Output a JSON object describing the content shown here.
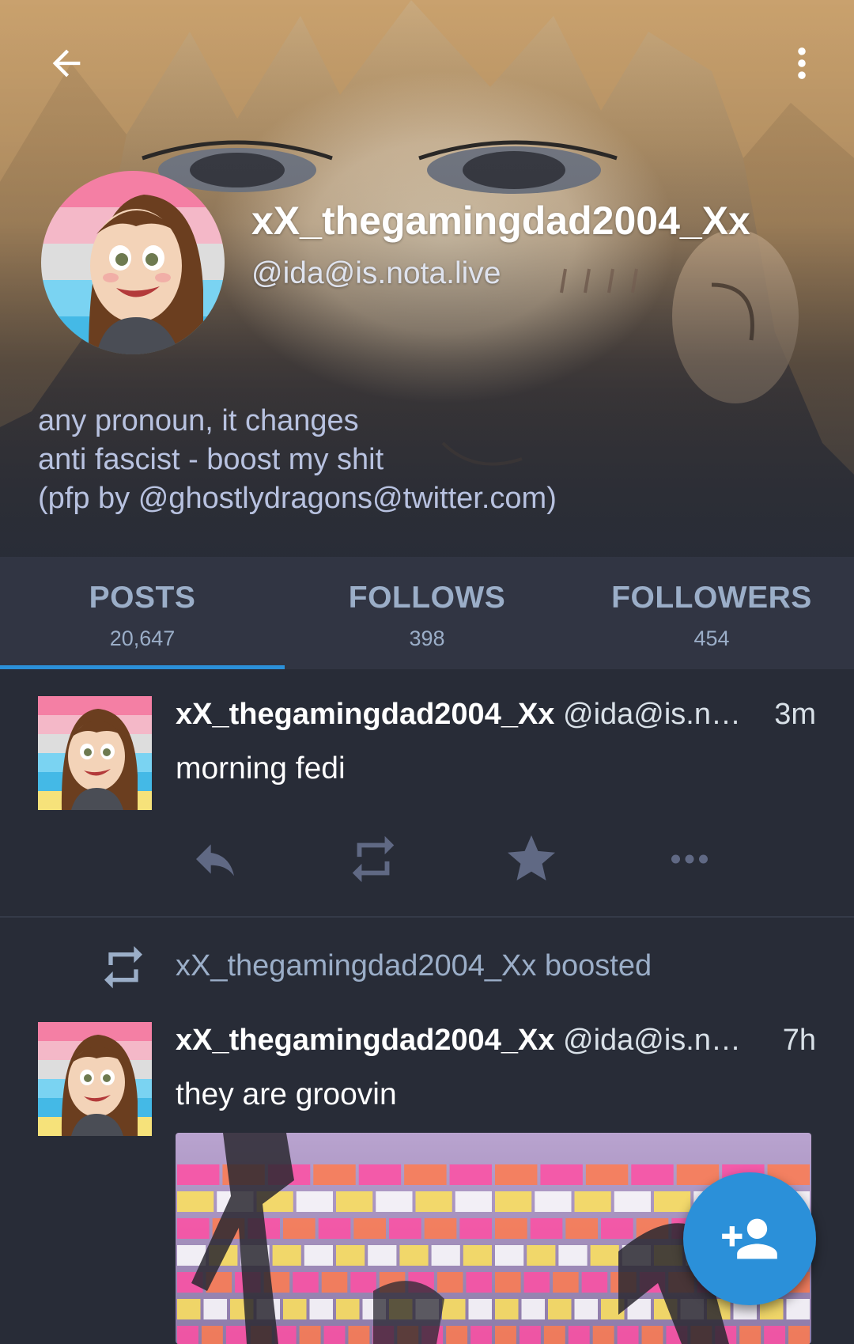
{
  "header": {
    "display_name": "xX_thegamingdad2004_Xx",
    "handle": "@ida@is.nota.live",
    "bio_lines": [
      "any pronoun, it changes",
      "anti fascist - boost my shit",
      "(pfp by @ghostlydragons@twitter.com)"
    ]
  },
  "tabs": [
    {
      "label": "POSTS",
      "count": "20,647",
      "active": true
    },
    {
      "label": "FOLLOWS",
      "count": "398",
      "active": false
    },
    {
      "label": "FOLLOWERS",
      "count": "454",
      "active": false
    }
  ],
  "statuses": [
    {
      "display_name": "xX_thegamingdad2004_Xx",
      "acct": "@ida@is.n…",
      "time": "3m",
      "text": "morning fedi"
    },
    {
      "boosted_by": "xX_thegamingdad2004_Xx boosted",
      "display_name": "xX_thegamingdad2004_Xx",
      "acct": "@ida@is.n…",
      "time": "7h",
      "text": "they are groovin"
    }
  ],
  "colors": {
    "background": "#282c37",
    "tab_bar": "#313543",
    "accent": "#2b90d9",
    "muted_text": "#9baec8",
    "action_icon": "#606984"
  },
  "icons": [
    "back-arrow-icon",
    "more-vert-icon",
    "reply-icon",
    "boost-icon",
    "favourite-star-icon",
    "more-horiz-icon",
    "add-person-icon"
  ]
}
